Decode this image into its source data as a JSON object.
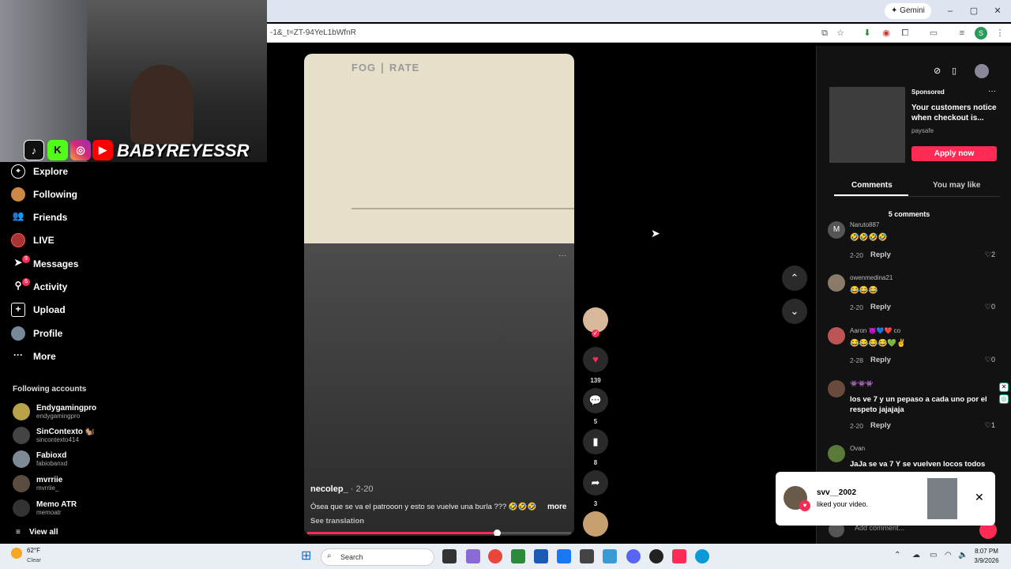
{
  "browser": {
    "gemini_label": "Gemini",
    "url": "-1&_t=ZT-94YeL1bWfnR",
    "window_controls": [
      "–",
      "▢",
      "✕"
    ]
  },
  "overlay": {
    "brand_name": "BABYREYESSR",
    "social_icons": [
      "tiktok-icon",
      "kick-icon",
      "instagram-icon",
      "youtube-icon"
    ]
  },
  "sidebar": {
    "items": [
      {
        "label": "Explore",
        "icon": "compass-icon"
      },
      {
        "label": "Following",
        "icon": "following-icon"
      },
      {
        "label": "Friends",
        "icon": "friends-icon"
      },
      {
        "label": "LIVE",
        "icon": "live-icon"
      },
      {
        "label": "Messages",
        "icon": "messages-icon",
        "badge": "9"
      },
      {
        "label": "Activity",
        "icon": "activity-icon",
        "badge": "6"
      },
      {
        "label": "Upload",
        "icon": "upload-icon"
      },
      {
        "label": "Profile",
        "icon": "profile-icon"
      },
      {
        "label": "More",
        "icon": "more-icon"
      }
    ],
    "following_heading": "Following accounts",
    "accounts": [
      {
        "name": "Endygamingpro",
        "handle": "endygamingpro"
      },
      {
        "name": "SinContexto 🐿️",
        "handle": "sincontexto414"
      },
      {
        "name": "Fabioxd",
        "handle": "fabiobanxd"
      },
      {
        "name": "mvrriie",
        "handle": "mvrriie_"
      },
      {
        "name": "Memo ATR",
        "handle": "memoatr"
      }
    ],
    "view_all": "View all"
  },
  "video": {
    "logo_text": "FOG ∣ RATE",
    "author": "necolep_",
    "date": "· 2-20",
    "caption": "Ósea que se va el patrooon y esto se vuelve una burla ??? 🤣🤣🤣",
    "more": "more",
    "see_translation": "See translation",
    "progress": 0.72
  },
  "actions": {
    "likes": "139",
    "comments": "5",
    "saves": "8",
    "shares": "3"
  },
  "ad": {
    "sponsored": "Sponsored",
    "title": "Your customers notice when checkout is...",
    "brand": "paysafe",
    "cta": "Apply now"
  },
  "tabs": {
    "comments": "Comments",
    "you_may_like": "You may like"
  },
  "comment_count": "5 comments",
  "comments": [
    {
      "avatar": "M",
      "user": "Naruto887",
      "text": "🤣🤣🤣🤣",
      "date": "2-20",
      "reply": "Reply",
      "likes": "2"
    },
    {
      "avatar": "",
      "user": "owenmedina21",
      "text": "😂😂😂",
      "date": "2-20",
      "reply": "Reply",
      "likes": "0"
    },
    {
      "avatar": "",
      "user": "Aaron 👿💙❤️ co",
      "text": "😂😂😂😂💚✌️",
      "date": "2-28",
      "reply": "Reply",
      "likes": "0"
    },
    {
      "avatar": "",
      "user": "👾👾👾",
      "text": "los ve 7 y un pepaso a cada uno por el respeto jajajaja",
      "date": "2-20",
      "reply": "Reply",
      "likes": "1"
    },
    {
      "avatar": "",
      "user": "Ovan",
      "text": "JaJa se va 7 Y se vuelven locos todos",
      "date": "",
      "reply": "",
      "likes": ""
    }
  ],
  "toast": {
    "user": "svv__2002",
    "message": "liked your video."
  },
  "add_comment_placeholder": "Add comment...",
  "taskbar": {
    "temperature": "62°F",
    "condition": "Clear",
    "search": "Search",
    "time": "8:07 PM",
    "date": "3/9/2026"
  }
}
